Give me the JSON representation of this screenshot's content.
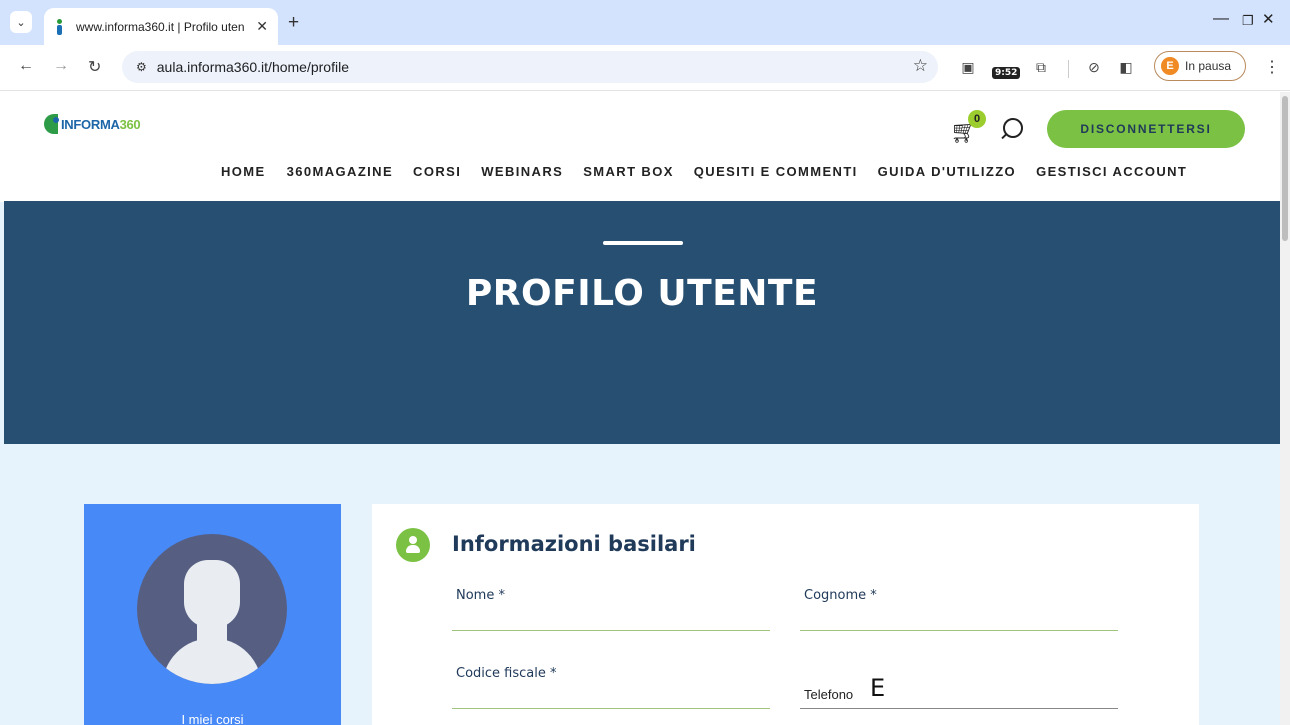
{
  "browser": {
    "tab_title": "www.informa360.it | Profilo uten",
    "new_tab_icon": "+",
    "url": "aula.informa360.it/home/profile",
    "profile_initial": "E",
    "profile_status": "In pausa",
    "ext_clock": "9:52"
  },
  "site": {
    "logo_text_a": "INFORMA",
    "logo_text_b": "360",
    "cart_count": "0",
    "logout_label": "DISCONNETTERSI",
    "nav": [
      "HOME",
      "360MAGAZINE",
      "CORSI",
      "WEBINARS",
      "SMART BOX",
      "QUESITI E COMMENTI",
      "GUIDA D'UTILIZZO",
      "GESTISCI ACCOUNT"
    ]
  },
  "hero": {
    "title": "PROFILO UTENTE"
  },
  "sidebar": {
    "link_label": "I miei corsi"
  },
  "form": {
    "section_title": "Informazioni basilari",
    "nome_label": "Nome *",
    "cognome_label": "Cognome *",
    "codice_fiscale_label": "Codice fiscale *",
    "telefono_label": "Telefono",
    "telefono_value": "E"
  },
  "colors": {
    "hero_bg": "#264f72",
    "accent_green": "#7bc143",
    "side_card_bg": "#4889f8",
    "page_bg": "#e6f3fc"
  }
}
